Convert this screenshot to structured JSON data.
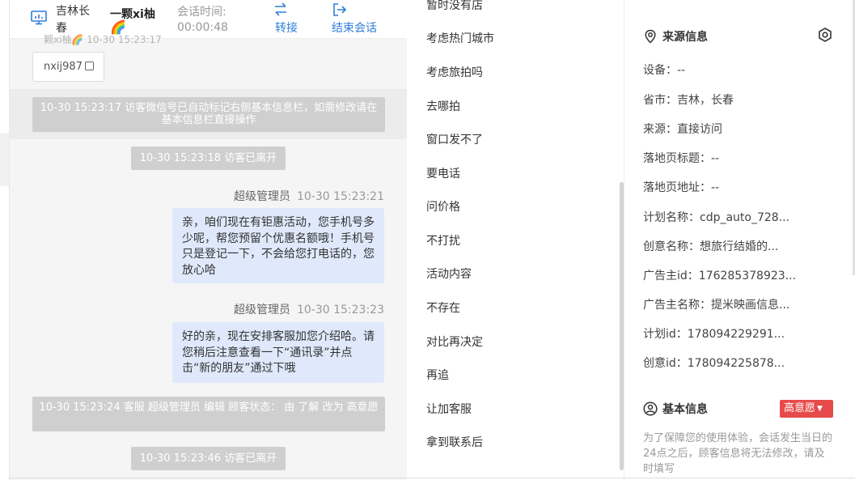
{
  "header": {
    "location": "吉林长春",
    "visitor_name": "一颗xi柚",
    "visitor_emoji": "🌈",
    "session_time_label": "会话时间:",
    "session_time": "00:00:48",
    "transfer_label": "转接",
    "end_label": "结束会话"
  },
  "chat": {
    "partial_row": "颗xi柚🌈  10-30 15:23:17",
    "wechat_id": "nxij987",
    "system_1": "10-30 15:23:17 访客微信号已自动标记右侧基本信息栏，如需修改请在基本信息栏直接操作",
    "system_2": "10-30 15:23:18 访客已离开",
    "msg1_sender": "超级管理员",
    "msg1_time": "10-30 15:23:21",
    "msg1_text": "亲，咱们现在有钜惠活动，您手机号多少呢，帮您预留个优惠名额哦！手机号只是登记一下，不会给您打电话的，您放心哈",
    "msg2_sender": "超级管理员",
    "msg2_time": "10-30 15:23:23",
    "msg2_text": "好的亲，现在安排客服加您介绍哈。请您稍后注意查看一下“通讯录”并点击“新的朋友”通过下哦",
    "system_3": "10-30 15:23:24 客服 超级管理员 编辑 顾客状态： 由 了解 改为 高意愿",
    "system_4": "10-30 15:23:46 访客已离开"
  },
  "middle_list": {
    "items": [
      "暂时没有店",
      "考虑热门城市",
      "考虑旅拍吗",
      "去哪拍",
      "窗口发不了",
      "要电话",
      "问价格",
      "不打扰",
      "活动内容",
      "不存在",
      "对比再决定",
      "再追",
      "让加客服",
      "拿到联系后"
    ]
  },
  "source_info": {
    "title": "来源信息",
    "rows": [
      "设备：--",
      "省市：吉林，长春",
      "来源：直接访问",
      "落地页标题：--",
      "落地页地址：--",
      "计划名称：cdp_auto_728...",
      "创意名称：想旅行结婚的...",
      "广告主id：176285378923...",
      "广告主名称：提米映画信息...",
      "计划id：178094229291...",
      "创意id：178094225878..."
    ]
  },
  "basic_info": {
    "title": "基本信息",
    "status_tag": "高意愿",
    "note": "为了保障您的使用体验，会话发生当日的24点之后，顾客信息将无法修改，请及时填写"
  },
  "colors": {
    "accent": "#2f7ed8",
    "bubble": "#dfe9fb",
    "system_msg": "#cfcfcf",
    "tag": "#e74a4a"
  }
}
